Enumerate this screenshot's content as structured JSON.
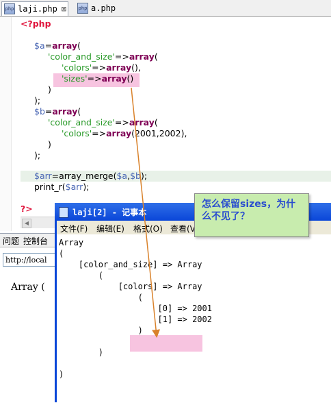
{
  "editor": {
    "tabs": [
      {
        "label": "laji.php",
        "close": "⊠"
      },
      {
        "label": "a.php"
      }
    ],
    "lines": {
      "open_tag": "<?php",
      "l1_var": "$a",
      "l1_kw": "array",
      "l1_rest": "=",
      "l1_paren": "(",
      "l2_str": "'color_and_size'",
      "l2_op": "=>",
      "l2_kw": "array",
      "l2_paren": "(",
      "l3_str": "'colors'",
      "l3_op": "=>",
      "l3_kw": "array",
      "l3_rest": "(),",
      "l4_str": "'sizes'",
      "l4_op": "=>",
      "l4_kw": "array",
      "l4_rest": "()",
      "l5": ")",
      "l6": ");",
      "l7_var": "$b",
      "l7_kw": "array",
      "l7_rest": "=",
      "l7_paren": "(",
      "l8_str": "'color_and_size'",
      "l8_op": "=>",
      "l8_kw": "array",
      "l8_paren": "(",
      "l9_str": "'colors'",
      "l9_op": "=>",
      "l9_kw": "array",
      "l9_rest": "(2001,2002),",
      "l10": ")",
      "l11": ");",
      "l12_var": "$arr",
      "l12_fn": "=array_merge(",
      "l12_a": "$a",
      "l12_c": ",",
      "l12_b": "$b",
      "l12_end": ");",
      "l13_fn": "print_r(",
      "l13_var": "$arr",
      "l13_end": ");",
      "close_tag": "?>"
    }
  },
  "panel": {
    "tabs": [
      "问题",
      "控制台"
    ],
    "url": "http://local",
    "output": "Array ("
  },
  "notepad": {
    "title": "laji[2] - 记事本",
    "menu": [
      "文件(F)",
      "编辑(E)",
      "格式(O)",
      "查看(V"
    ],
    "lines": [
      "Array",
      "(",
      "    [color_and_size] => Array",
      "        (",
      "            [colors] => Array",
      "                (",
      "                    [0] => 2001",
      "                    [1] => 2002",
      "                )",
      "",
      "        )",
      "",
      ")"
    ]
  },
  "callout": {
    "text": "怎么保留sizes，为什么不见了？"
  },
  "colors": {
    "callout_bg": "#c8ecae",
    "callout_text": "#2a4dcf",
    "highlight": "#f7c4e0",
    "arrow": "#d9822b"
  }
}
